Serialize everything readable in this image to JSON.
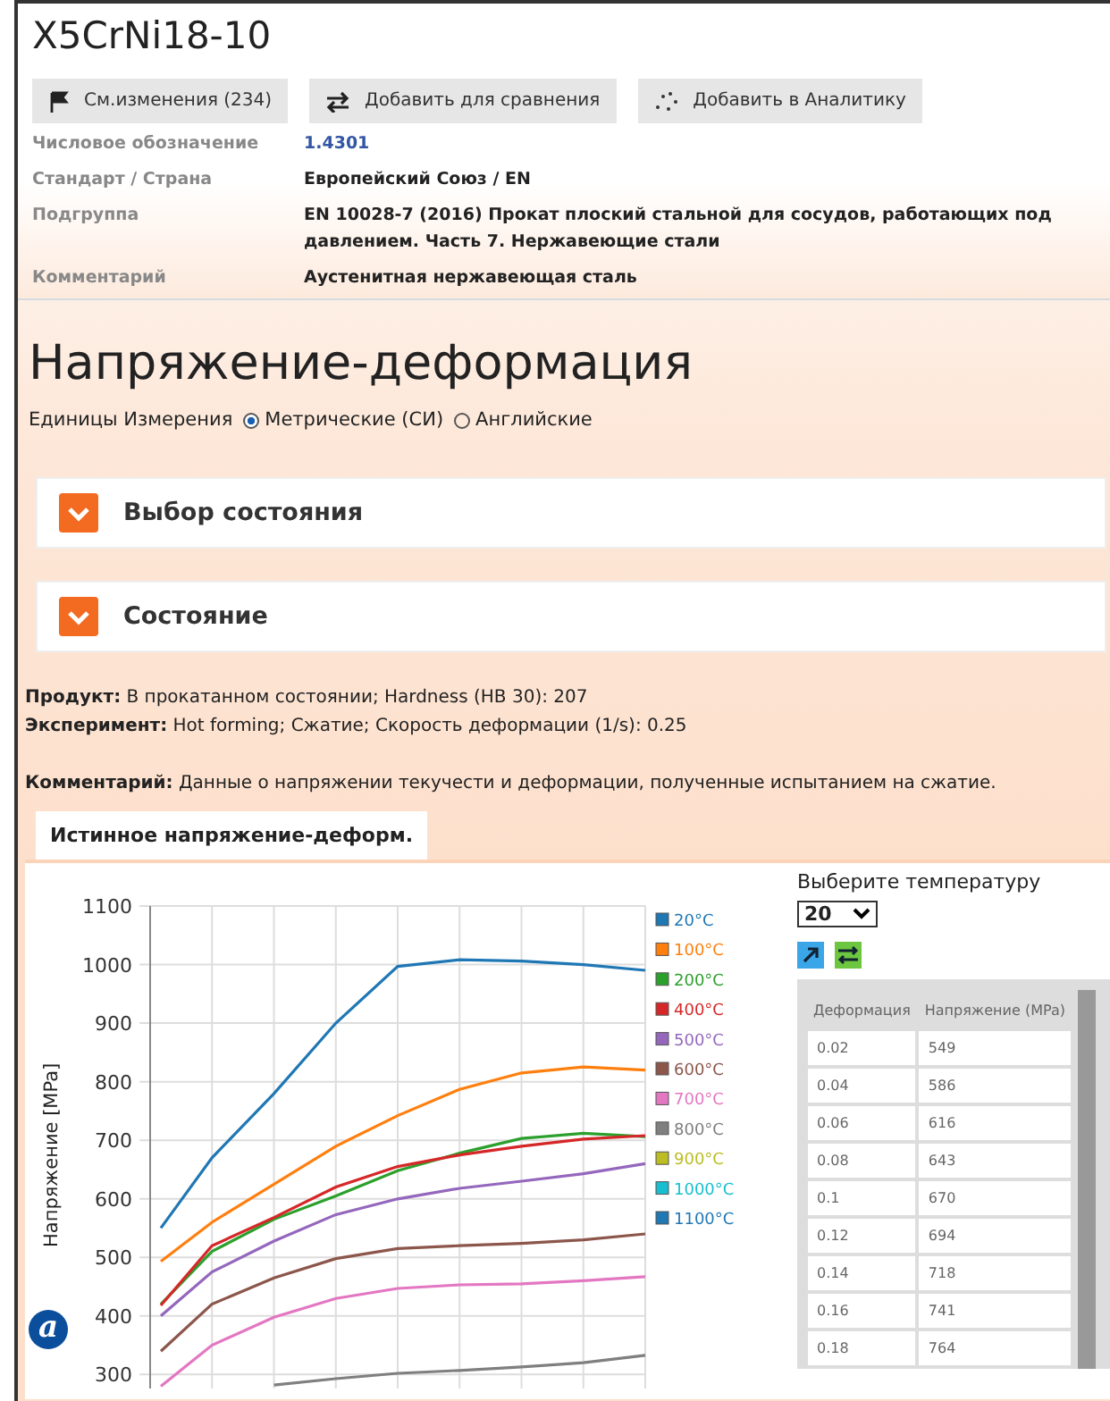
{
  "header": {
    "title": "X5CrNi18-10",
    "buttons": [
      {
        "kind": "flag",
        "label": "См.изменения (234)"
      },
      {
        "kind": "compare",
        "label": "Добавить для сравнения"
      },
      {
        "kind": "analytics",
        "label": "Добавить в Аналитику"
      }
    ],
    "properties": [
      {
        "label": "Числовое обозначение",
        "value": "1.4301",
        "kind": "link"
      },
      {
        "label": "Стандарт / Страна",
        "value": "Европейский Союз / EN",
        "kind": "text"
      },
      {
        "label": "Подгруппа",
        "value": "EN 10028-7 (2016) Прокат плоский стальной для сосудов, работающих под давлением. Часть 7. Нержавеющие стали",
        "kind": "text"
      },
      {
        "label": "Комментарий",
        "value": "Аустенитная нержавеющая сталь",
        "kind": "text"
      }
    ]
  },
  "section_title": "Напряжение-деформация",
  "units": {
    "label": "Единицы Измерения",
    "options": [
      {
        "label": "Метрические (СИ)",
        "selected": true
      },
      {
        "label": "Английские",
        "selected": false
      }
    ]
  },
  "panels": [
    {
      "title": "Выбор состояния",
      "expanded": false
    },
    {
      "title": "Состояние",
      "expanded": false
    }
  ],
  "info": [
    {
      "label": "Продукт:",
      "text": "В прокатанном состоянии; Hardness (HB 30): 207"
    },
    {
      "label": "Эксперимент:",
      "text": "Hot forming; Сжатие; Скорость деформации (1/s): 0.25"
    },
    {
      "label": "Комментарий:",
      "text": "Данные о напряжении текучести и деформации, полученные испытанием на сжатие."
    }
  ],
  "tabs": [
    {
      "label": "Истинное напряжение-деформ.",
      "selected": true
    }
  ],
  "chart_data": {
    "type": "line",
    "grid": true,
    "legend": true,
    "ylabel": "Напряжение [MPa]",
    "ylim": [
      270,
      1100
    ],
    "yticks": [
      300,
      400,
      500,
      600,
      700,
      800,
      900,
      1000,
      1100
    ],
    "series": [
      {
        "name": "20°C",
        "color": "#1f77b4",
        "values": [
          550,
          670,
          780,
          900,
          997,
          1008,
          1006,
          1000,
          990
        ]
      },
      {
        "name": "100°C",
        "color": "#ff7f0e",
        "values": [
          493,
          560,
          625,
          690,
          742,
          787,
          815,
          825,
          820
        ]
      },
      {
        "name": "200°C",
        "color": "#2ca02c",
        "values": [
          420,
          510,
          565,
          605,
          648,
          678,
          703,
          712,
          706
        ]
      },
      {
        "name": "400°C",
        "color": "#d62728",
        "values": [
          418,
          520,
          568,
          620,
          655,
          675,
          690,
          702,
          708
        ]
      },
      {
        "name": "500°C",
        "color": "#9467bd",
        "values": [
          400,
          475,
          528,
          573,
          600,
          618,
          630,
          643,
          660
        ]
      },
      {
        "name": "600°C",
        "color": "#8c564b",
        "values": [
          340,
          420,
          465,
          498,
          515,
          520,
          524,
          530,
          540
        ]
      },
      {
        "name": "700°C",
        "color": "#e377c2",
        "values": [
          280,
          350,
          398,
          430,
          447,
          453,
          455,
          460,
          467
        ]
      },
      {
        "name": "800°C",
        "color": "#7f7f7f",
        "values": [
          null,
          null,
          282,
          293,
          302,
          307,
          313,
          320,
          333
        ]
      },
      {
        "name": "900°C",
        "color": "#bcbd22",
        "values": [
          null,
          null,
          null,
          null,
          null,
          null,
          null,
          null,
          null
        ]
      },
      {
        "name": "1000°C",
        "color": "#17becf",
        "values": [
          null,
          null,
          null,
          null,
          null,
          null,
          null,
          null,
          null
        ]
      },
      {
        "name": "1100°C",
        "color": "#1f77b4",
        "values": [
          null,
          null,
          null,
          null,
          null,
          null,
          null,
          null,
          null
        ]
      }
    ]
  },
  "figure_label": "a",
  "temperature": {
    "label": "Выберите температуру",
    "value": "20"
  },
  "table": {
    "columns": [
      "Деформация",
      "Напряжение (MPa)"
    ],
    "rows": [
      [
        "0.02",
        "549"
      ],
      [
        "0.04",
        "586"
      ],
      [
        "0.06",
        "616"
      ],
      [
        "0.08",
        "643"
      ],
      [
        "0.1",
        "670"
      ],
      [
        "0.12",
        "694"
      ],
      [
        "0.14",
        "718"
      ],
      [
        "0.16",
        "741"
      ],
      [
        "0.18",
        "764"
      ]
    ]
  }
}
